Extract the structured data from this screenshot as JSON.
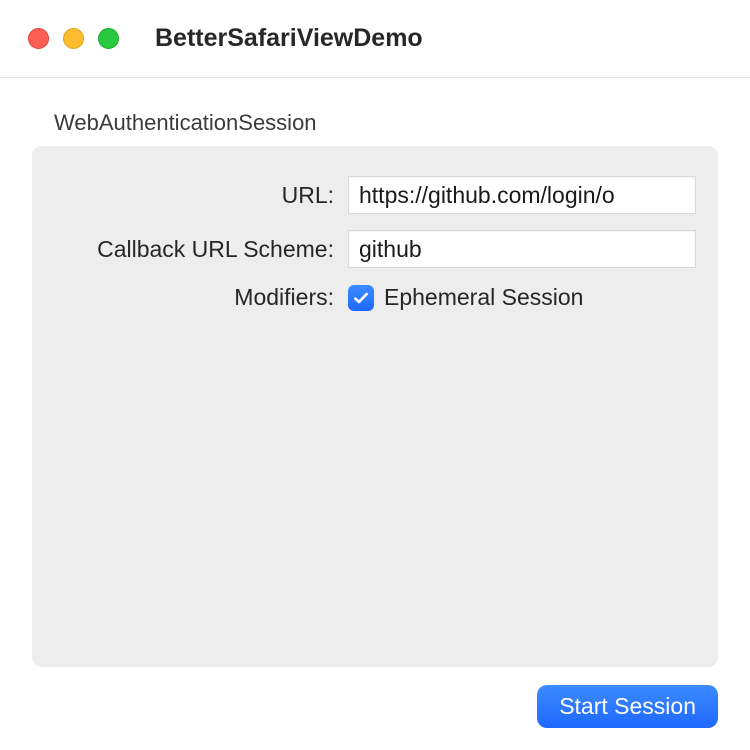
{
  "window": {
    "title": "BetterSafariViewDemo"
  },
  "section": {
    "heading": "WebAuthenticationSession"
  },
  "form": {
    "url": {
      "label": "URL:",
      "value": "https://github.com/login/o"
    },
    "callback": {
      "label": "Callback URL Scheme:",
      "value": "github"
    },
    "modifiers": {
      "label": "Modifiers:",
      "ephemeral_label": "Ephemeral Session",
      "ephemeral_checked": true
    }
  },
  "actions": {
    "start_label": "Start Session"
  },
  "colors": {
    "accent": "#1e68ff"
  }
}
